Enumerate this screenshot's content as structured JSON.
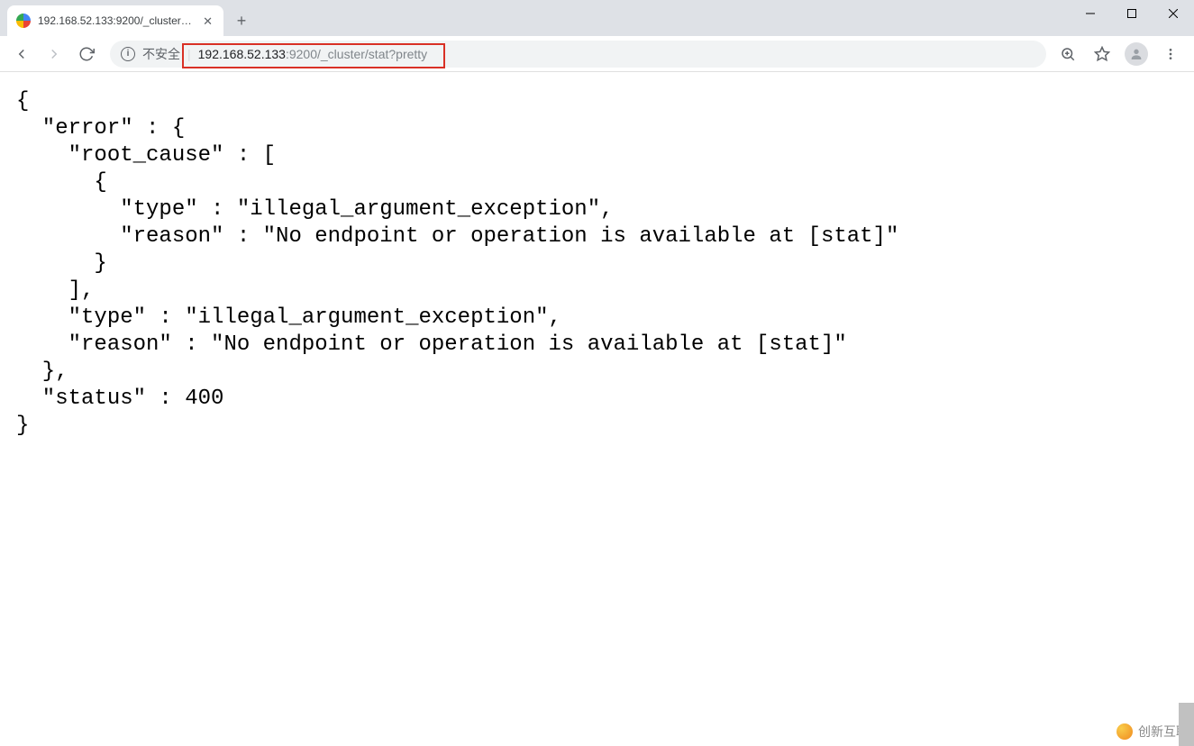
{
  "window": {
    "tab_title": "192.168.52.133:9200/_cluster/…"
  },
  "toolbar": {
    "insecure_label": "不安全",
    "url_host": "192.168.52.133",
    "url_port_path": ":9200/_cluster/stat?pretty"
  },
  "body": {
    "json_text": "{\n  \"error\" : {\n    \"root_cause\" : [\n      {\n        \"type\" : \"illegal_argument_exception\",\n        \"reason\" : \"No endpoint or operation is available at [stat]\"\n      }\n    ],\n    \"type\" : \"illegal_argument_exception\",\n    \"reason\" : \"No endpoint or operation is available at [stat]\"\n  },\n  \"status\" : 400\n}"
  },
  "watermark": {
    "text": "创新互联"
  }
}
